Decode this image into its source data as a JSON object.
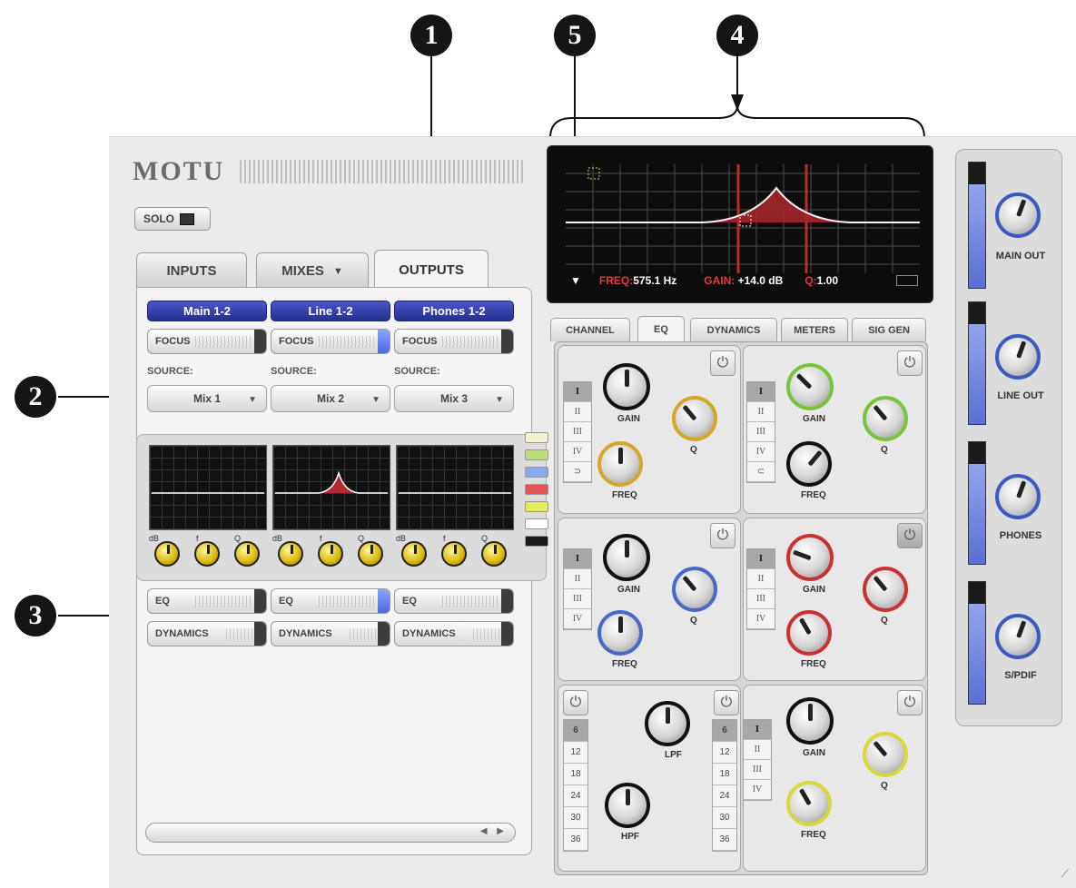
{
  "callouts": {
    "c1": "1",
    "c2": "2",
    "c3": "3",
    "c4": "4",
    "c5": "5"
  },
  "header": {
    "logo": "MOTU",
    "solo_label": "SOLO"
  },
  "tabs": {
    "inputs": "INPUTS",
    "mixes": "MIXES",
    "mixes_arrow": "▼",
    "outputs": "OUTPUTS"
  },
  "channels": [
    {
      "name": "Main 1-2",
      "focus": "FOCUS",
      "source_label": "SOURCE:",
      "source": "Mix 1",
      "eq": "EQ",
      "dynamics": "DYNAMICS"
    },
    {
      "name": "Line 1-2",
      "focus": "FOCUS",
      "source_label": "SOURCE:",
      "source": "Mix 2",
      "eq": "EQ",
      "dynamics": "DYNAMICS"
    },
    {
      "name": "Phones 1-2",
      "focus": "FOCUS",
      "source_label": "SOURCE:",
      "source": "Mix 3",
      "eq": "EQ",
      "dynamics": "DYNAMICS"
    }
  ],
  "mini_knob_labels": [
    "dB",
    "f",
    "Q"
  ],
  "eq_graph": {
    "freq_label": "FREQ:",
    "freq_value": "575.1 Hz",
    "gain_label": "GAIN:",
    "gain_value": "+14.0 dB",
    "q_label": "Q:",
    "q_value": "1.00"
  },
  "right_tabs": {
    "channel": "CHANNEL",
    "eq": "EQ",
    "dynamics": "DYNAMICS",
    "meters": "METERS",
    "sig_gen": "SIG GEN"
  },
  "bands": {
    "roman": [
      "I",
      "II",
      "III",
      "IV"
    ],
    "gain": "GAIN",
    "freq": "FREQ",
    "q": "Q",
    "lpf": "LPF",
    "hpf": "HPF",
    "slopes": [
      "6",
      "12",
      "18",
      "24",
      "30",
      "36"
    ]
  },
  "outputs": {
    "main": "MAIN OUT",
    "line": "LINE OUT",
    "phones": "PHONES",
    "spdif": "S/PDIF"
  },
  "colors": {
    "accent_blue": "#2a3799",
    "eq_curve_red": "#c0282b"
  }
}
